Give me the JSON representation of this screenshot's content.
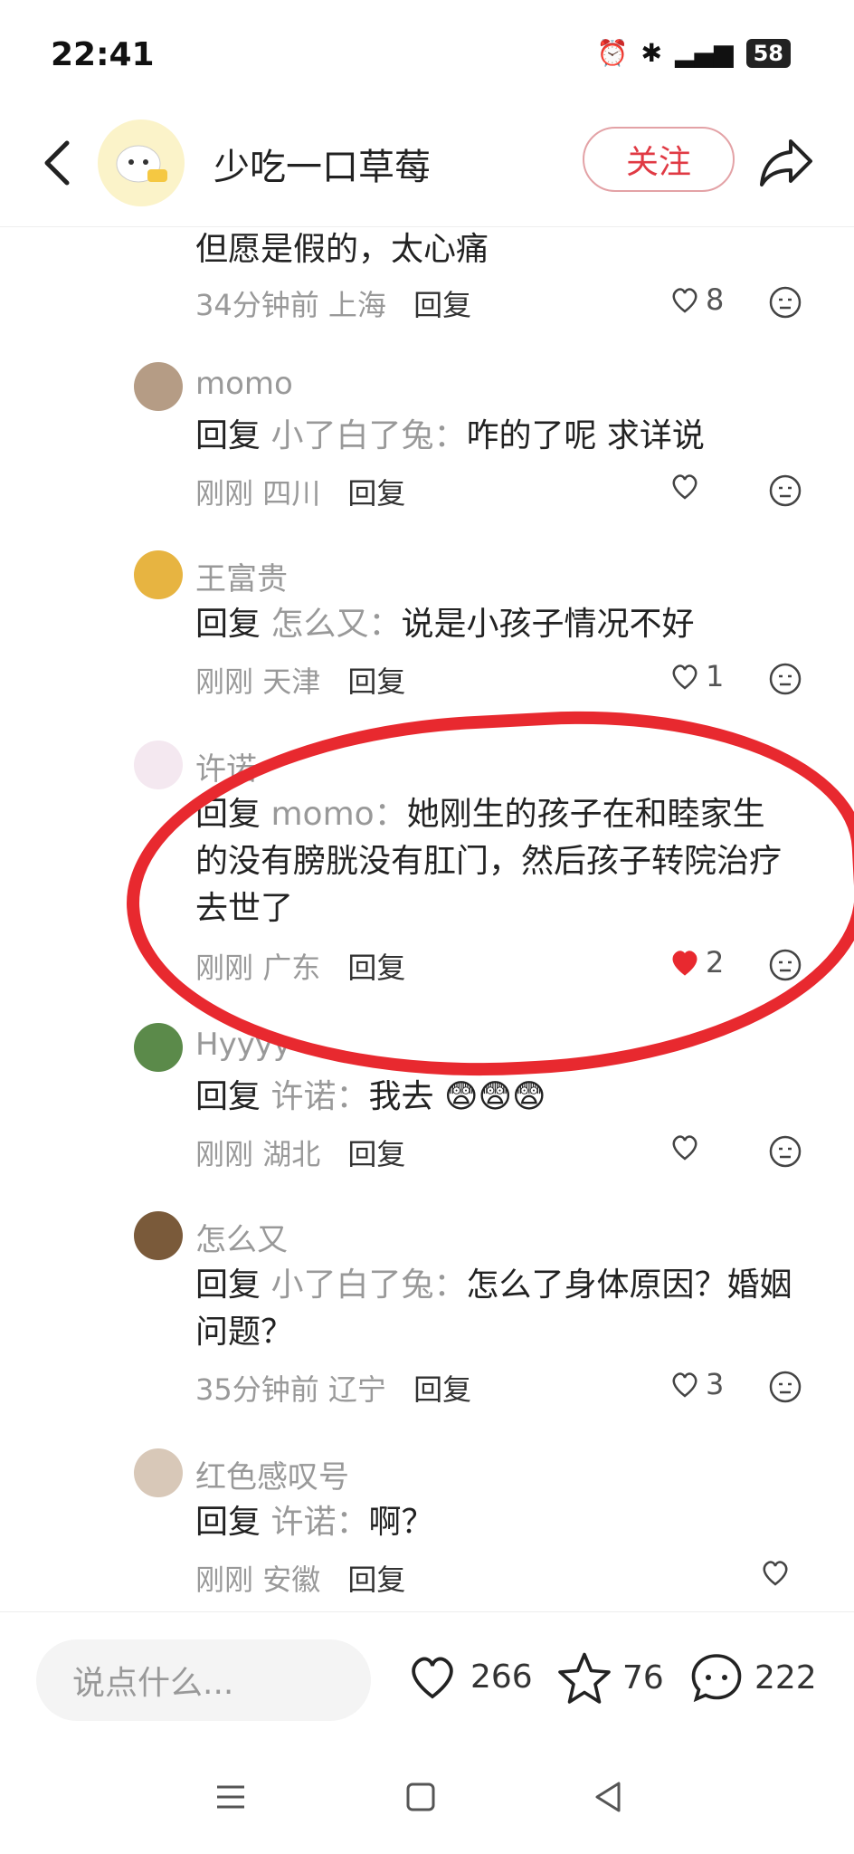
{
  "status": {
    "time": "22:41",
    "battery": "58"
  },
  "header": {
    "title": "少吃一口草莓",
    "follow_label": "关注"
  },
  "comments": [
    {
      "text": "但愿是假的，太心痛",
      "meta_time": "34分钟前",
      "meta_loc": "上海",
      "reply_label": "回复",
      "likes": "8"
    },
    {
      "name": "momo",
      "reply_prefix": "回复",
      "reply_to": "小了白了兔：",
      "text": "咋的了呢 求详说",
      "meta_time": "刚刚",
      "meta_loc": "四川",
      "reply_label": "回复",
      "likes": ""
    },
    {
      "name": "王富贵",
      "reply_prefix": "回复",
      "reply_to": "怎么又：",
      "text": "说是小孩子情况不好",
      "meta_time": "刚刚",
      "meta_loc": "天津",
      "reply_label": "回复",
      "likes": "1"
    },
    {
      "name": "许诺",
      "reply_prefix": "回复",
      "reply_to": "momo：",
      "text": "她刚生的孩子在和睦家生的没有膀胱没有肛门，然后孩子转院治疗去世了",
      "meta_time": "刚刚",
      "meta_loc": "广东",
      "reply_label": "回复",
      "likes": "2"
    },
    {
      "name": "Hyyyy",
      "reply_prefix": "回复",
      "reply_to": "许诺：",
      "text": "我去",
      "meta_time": "刚刚",
      "meta_loc": "湖北",
      "reply_label": "回复",
      "likes": ""
    },
    {
      "name": "怎么又",
      "reply_prefix": "回复",
      "reply_to": "小了白了兔：",
      "text": "怎么了身体原因？婚姻问题？",
      "meta_time": "35分钟前",
      "meta_loc": "辽宁",
      "reply_label": "回复",
      "likes": "3"
    },
    {
      "name": "红色感叹号",
      "reply_prefix": "回复",
      "reply_to": "许诺：",
      "text": "啊？",
      "meta_time": "刚刚",
      "meta_loc": "安徽",
      "reply_label": "回复",
      "likes": ""
    }
  ],
  "bottom": {
    "input_placeholder": "说点什么...",
    "like_count": "266",
    "star_count": "76",
    "comment_count": "222"
  }
}
